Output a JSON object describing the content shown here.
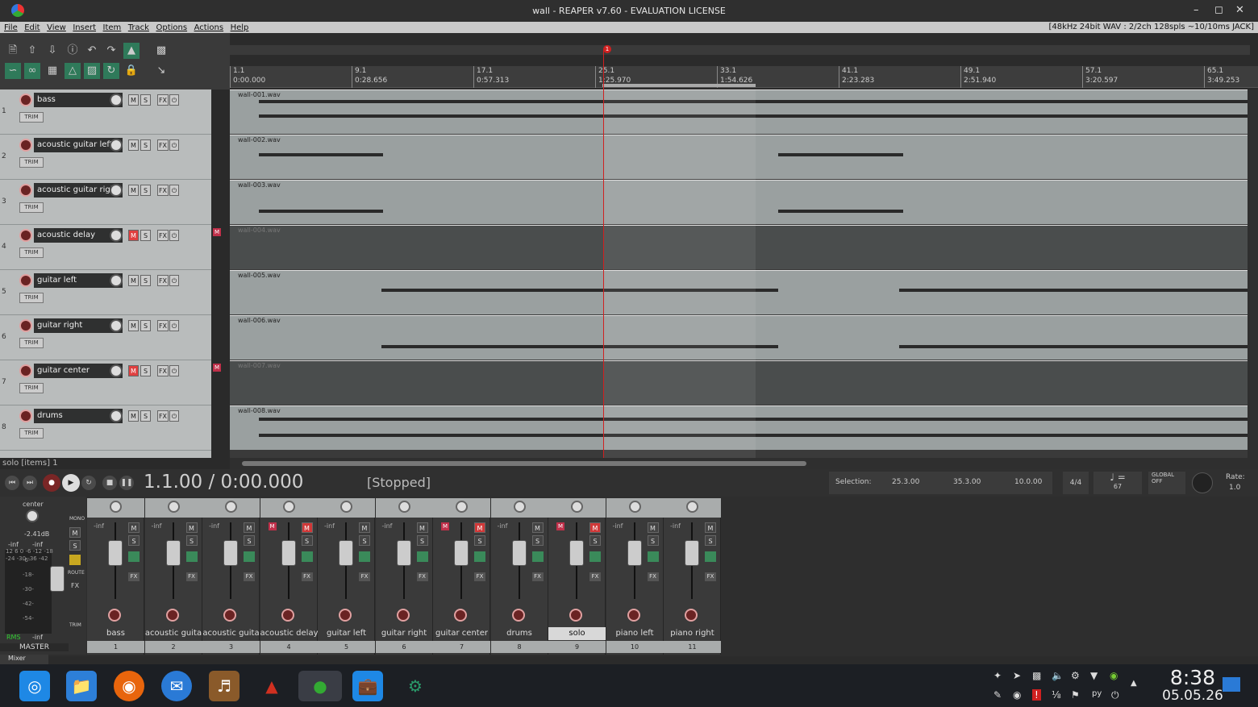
{
  "window": {
    "title": "wall - REAPER v7.60 - EVALUATION LICENSE",
    "min_icon": "minimize-icon",
    "max_icon": "maximize-icon",
    "close_icon": "close-icon"
  },
  "menu": {
    "items": [
      "File",
      "Edit",
      "View",
      "Insert",
      "Item",
      "Track",
      "Options",
      "Actions",
      "Help"
    ],
    "info": "[48kHz 24bit WAV : 2/2ch 128spls ~10/10ms JACK]"
  },
  "ruler": {
    "marks": [
      {
        "bar": "1.1",
        "time": "0:00.000"
      },
      {
        "bar": "9.1",
        "time": "0:28.656"
      },
      {
        "bar": "17.1",
        "time": "0:57.313"
      },
      {
        "bar": "25.1",
        "time": "1:25.970"
      },
      {
        "bar": "33.1",
        "time": "1:54.626"
      },
      {
        "bar": "41.1",
        "time": "2:23.283"
      },
      {
        "bar": "49.1",
        "time": "2:51.940"
      },
      {
        "bar": "57.1",
        "time": "3:20.597"
      },
      {
        "bar": "65.1",
        "time": "3:49.253"
      }
    ],
    "marker": "1"
  },
  "tracks": [
    {
      "num": "1",
      "name": "bass",
      "muted": false,
      "item": "wall-001.wav",
      "trim": "TRIM"
    },
    {
      "num": "2",
      "name": "acoustic guitar left",
      "muted": false,
      "item": "wall-002.wav",
      "trim": "TRIM"
    },
    {
      "num": "3",
      "name": "acoustic guitar righ",
      "muted": false,
      "item": "wall-003.wav",
      "trim": "TRIM"
    },
    {
      "num": "4",
      "name": "acoustic delay",
      "muted": true,
      "item": "wall-004.wav",
      "trim": "TRIM"
    },
    {
      "num": "5",
      "name": "guitar left",
      "muted": false,
      "item": "wall-005.wav",
      "trim": "TRIM"
    },
    {
      "num": "6",
      "name": "guitar right",
      "muted": false,
      "item": "wall-006.wav",
      "trim": "TRIM"
    },
    {
      "num": "7",
      "name": "guitar center",
      "muted": true,
      "item": "wall-007.wav",
      "trim": "TRIM"
    },
    {
      "num": "8",
      "name": "drums",
      "muted": false,
      "item": "wall-008.wav",
      "trim": "TRIM"
    }
  ],
  "track_buttons": {
    "m": "M",
    "s": "S",
    "fx": "FX",
    "mute_flag": "M"
  },
  "status": "solo [items] 1",
  "transport": {
    "position": "1.1.00 / 0:00.000",
    "state": "[Stopped]",
    "selection_label": "Selection:",
    "sel_start": "25.3.00",
    "sel_end": "35.3.00",
    "sel_len": "10.0.00",
    "timesig": "4/4",
    "bpm": "67",
    "rate_label": "Rate:",
    "rate": "1.0",
    "global": "GLOBAL",
    "global_state": "OFF"
  },
  "master": {
    "label": "MASTER",
    "pan": "center",
    "db": "-2.41dB",
    "inf_l": "-inf",
    "inf_r": "-inf",
    "rms": "RMS",
    "rms_val": "-inf",
    "mono": "MONO",
    "route": "ROUTE",
    "fx": "FX",
    "trim": "TRIM",
    "scale": [
      "12",
      "6",
      "0",
      "-6",
      "-12",
      "-18",
      "-24",
      "-30",
      "-36",
      "-42"
    ],
    "scale2": [
      "-6-",
      "-18-",
      "-30-",
      "-42-",
      "-54-"
    ]
  },
  "mixer": [
    {
      "name": "bass",
      "idx": "1",
      "inf": "-inf",
      "muted": false,
      "selected": false
    },
    {
      "name": "acoustic guita",
      "idx": "2",
      "inf": "-inf",
      "muted": false,
      "selected": false
    },
    {
      "name": "acoustic guita",
      "idx": "3",
      "inf": "-inf",
      "muted": false,
      "selected": false
    },
    {
      "name": "acoustic delay",
      "idx": "4",
      "inf": "",
      "muted": true,
      "selected": false
    },
    {
      "name": "guitar left",
      "idx": "5",
      "inf": "-inf",
      "muted": false,
      "selected": false
    },
    {
      "name": "guitar right",
      "idx": "6",
      "inf": "-inf",
      "muted": false,
      "selected": false
    },
    {
      "name": "guitar center",
      "idx": "7",
      "inf": "",
      "muted": true,
      "selected": false
    },
    {
      "name": "drums",
      "idx": "8",
      "inf": "-inf",
      "muted": false,
      "selected": false
    },
    {
      "name": "solo",
      "idx": "9",
      "inf": "",
      "muted": true,
      "selected": true
    },
    {
      "name": "piano left",
      "idx": "10",
      "inf": "-inf",
      "muted": false,
      "selected": false
    },
    {
      "name": "piano right",
      "idx": "11",
      "inf": "-inf",
      "muted": false,
      "selected": false
    }
  ],
  "mixer_tab": "Mixer",
  "taskbar": {
    "apps": [
      "launcher-icon",
      "files-icon",
      "firefox-icon",
      "thunderbird-icon",
      "ardour-icon",
      "reaper-alt-icon",
      "reaper-icon",
      "store-icon",
      "settings-app-icon"
    ],
    "time": "8:38",
    "date": "05.05.26",
    "lang": "ру"
  },
  "colors": {
    "accent_red": "#d02020",
    "mute_red": "#e04040",
    "track_bg": "#b9bcbc",
    "arrange_bg": "#3a3a3a"
  }
}
